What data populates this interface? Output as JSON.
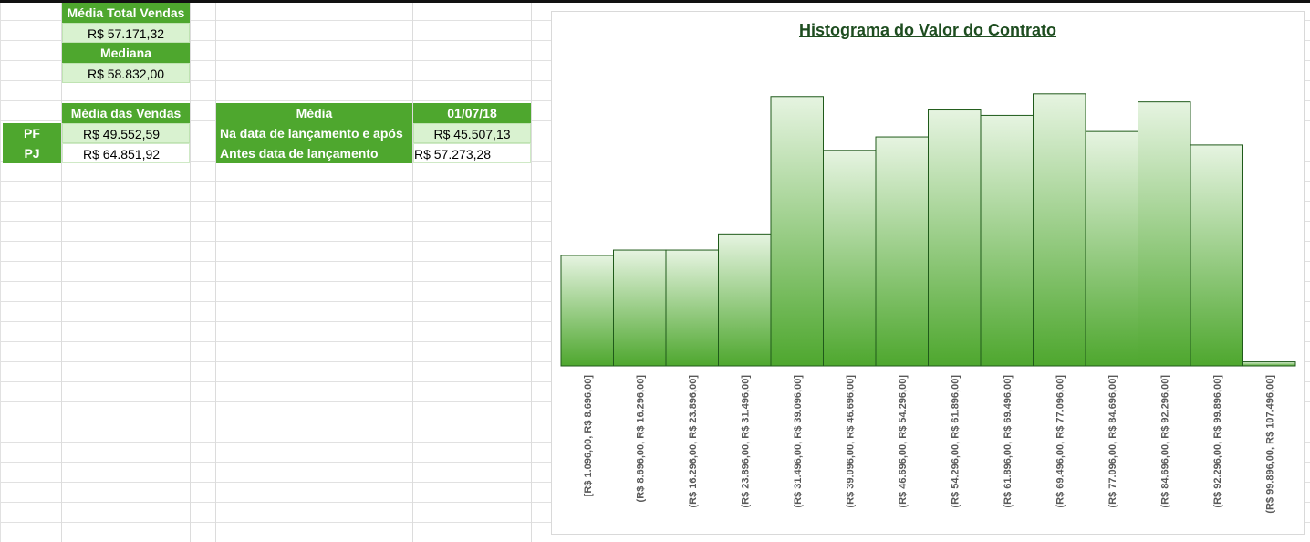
{
  "stats": {
    "media_total_label": "Média Total Vendas",
    "media_total_value": "R$ 57.171,32",
    "mediana_label": "Mediana",
    "mediana_value": "R$ 58.832,00",
    "media_vendas_label": "Média das Vendas",
    "pf_label": "PF",
    "pf_value": "R$ 49.552,59",
    "pj_label": "PJ",
    "pj_value": "R$ 64.851,92"
  },
  "launch_table": {
    "media_label": "Média",
    "date_label": "01/07/18",
    "row1_label": "Na data de lançamento e após",
    "row1_value": "R$ 45.507,13",
    "row2_label": "Antes data de lançamento",
    "row2_value": "R$ 57.273,28"
  },
  "chart_data": {
    "type": "bar",
    "title": "Histograma do Valor do Contrato",
    "categories": [
      "[R$ 1.096,00, R$ 8.696,00]",
      "(R$ 8.696,00, R$ 16.296,00]",
      "(R$ 16.296,00, R$ 23.896,00]",
      "(R$ 23.896,00, R$ 31.496,00]",
      "(R$ 31.496,00, R$ 39.096,00]",
      "(R$ 39.096,00, R$ 46.696,00]",
      "(R$ 46.696,00, R$ 54.296,00]",
      "(R$ 54.296,00, R$ 61.896,00]",
      "(R$ 61.896,00, R$ 69.496,00]",
      "(R$ 69.496,00, R$ 77.096,00]",
      "(R$ 77.096,00, R$ 84.696,00]",
      "(R$ 84.696,00, R$ 92.296,00]",
      "(R$ 92.296,00, R$ 99.896,00]",
      "(R$ 99.896,00, R$ 107.496,00]"
    ],
    "values": [
      41,
      43,
      43,
      49,
      100,
      80,
      85,
      95,
      93,
      101,
      87,
      98,
      82,
      1.5
    ],
    "ylim": [
      0,
      105
    ],
    "xlabel": "",
    "ylabel": "",
    "grid": false,
    "colors": {
      "bar_top": "#e6f4e1",
      "bar_bottom": "#4ea72e",
      "bar_border": "#1f5a1a",
      "label": "#595959"
    }
  }
}
